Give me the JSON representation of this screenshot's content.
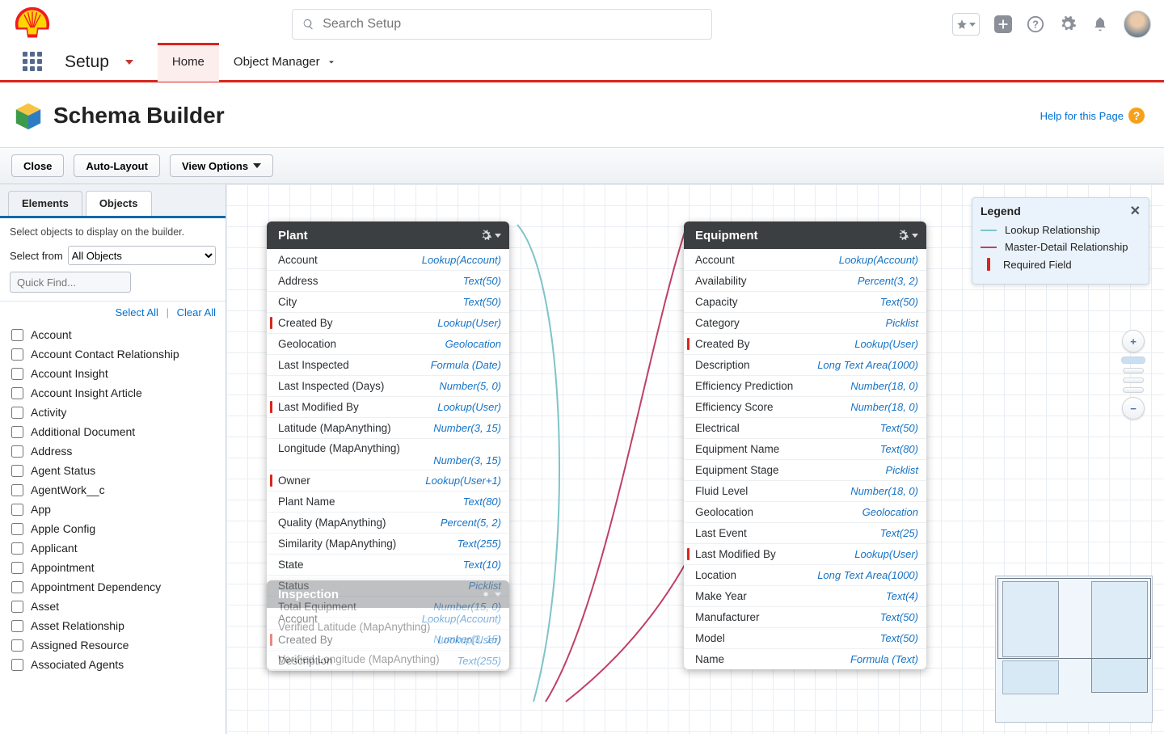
{
  "search": {
    "placeholder": "Search Setup"
  },
  "nav": {
    "app_title": "Setup",
    "tabs": [
      {
        "label": "Home",
        "active": true
      },
      {
        "label": "Object Manager",
        "active": false
      }
    ]
  },
  "page": {
    "title": "Schema Builder",
    "help_label": "Help for this Page"
  },
  "toolbar": {
    "close": "Close",
    "auto_layout": "Auto-Layout",
    "view_options": "View Options"
  },
  "sidebar": {
    "tabs": {
      "elements": "Elements",
      "objects": "Objects"
    },
    "help_text": "Select objects to display on the builder.",
    "select_from_label": "Select from",
    "select_from_value": "All Objects",
    "quickfind_placeholder": "Quick Find...",
    "select_all": "Select All",
    "clear_all": "Clear All",
    "objects": [
      "Account",
      "Account Contact Relationship",
      "Account Insight",
      "Account Insight Article",
      "Activity",
      "Additional Document",
      "Address",
      "Agent Status",
      "AgentWork__c",
      "App",
      "Apple Config",
      "Applicant",
      "Appointment",
      "Appointment Dependency",
      "Asset",
      "Asset Relationship",
      "Assigned Resource",
      "Associated Agents"
    ]
  },
  "legend": {
    "title": "Legend",
    "lookup": "Lookup Relationship",
    "master": "Master-Detail Relationship",
    "required": "Required Field"
  },
  "entities": {
    "plant": {
      "title": "Plant",
      "fields": [
        {
          "name": "Account",
          "type": "Lookup(Account)",
          "required": false
        },
        {
          "name": "Address",
          "type": "Text(50)",
          "required": false
        },
        {
          "name": "City",
          "type": "Text(50)",
          "required": false
        },
        {
          "name": "Created By",
          "type": "Lookup(User)",
          "required": true
        },
        {
          "name": "Geolocation",
          "type": "Geolocation",
          "required": false
        },
        {
          "name": "Last Inspected",
          "type": "Formula (Date)",
          "required": false
        },
        {
          "name": "Last Inspected (Days)",
          "type": "Number(5, 0)",
          "required": false
        },
        {
          "name": "Last Modified By",
          "type": "Lookup(User)",
          "required": true
        },
        {
          "name": "Latitude (MapAnything)",
          "type": "Number(3, 15)",
          "required": false
        },
        {
          "name": "Longitude (MapAnything)",
          "type": "Number(3, 15)",
          "required": false,
          "wrap": true
        },
        {
          "name": "Owner",
          "type": "Lookup(User+1)",
          "required": true
        },
        {
          "name": "Plant Name",
          "type": "Text(80)",
          "required": false
        },
        {
          "name": "Quality (MapAnything)",
          "type": "Percent(5, 2)",
          "required": false
        },
        {
          "name": "Similarity (MapAnything)",
          "type": "Text(255)",
          "required": false
        },
        {
          "name": "State",
          "type": "Text(10)",
          "required": false
        },
        {
          "name": "Status",
          "type": "Picklist",
          "required": false
        },
        {
          "name": "Total Equipment",
          "type": "Number(15, 0)",
          "required": false
        },
        {
          "name": "Verified Latitude (MapAnything)",
          "type": "Number(3, 15)",
          "required": false,
          "wrap": true
        },
        {
          "name": "Verified Longitude (MapAnything)",
          "type": "",
          "required": false
        }
      ]
    },
    "equipment": {
      "title": "Equipment",
      "fields": [
        {
          "name": "Account",
          "type": "Lookup(Account)",
          "required": false
        },
        {
          "name": "Availability",
          "type": "Percent(3, 2)",
          "required": false
        },
        {
          "name": "Capacity",
          "type": "Text(50)",
          "required": false
        },
        {
          "name": "Category",
          "type": "Picklist",
          "required": false
        },
        {
          "name": "Created By",
          "type": "Lookup(User)",
          "required": true
        },
        {
          "name": "Description",
          "type": "Long Text Area(1000)",
          "required": false
        },
        {
          "name": "Efficiency Prediction",
          "type": "Number(18, 0)",
          "required": false
        },
        {
          "name": "Efficiency Score",
          "type": "Number(18, 0)",
          "required": false
        },
        {
          "name": "Electrical",
          "type": "Text(50)",
          "required": false
        },
        {
          "name": "Equipment Name",
          "type": "Text(80)",
          "required": false
        },
        {
          "name": "Equipment Stage",
          "type": "Picklist",
          "required": false
        },
        {
          "name": "Fluid Level",
          "type": "Number(18, 0)",
          "required": false
        },
        {
          "name": "Geolocation",
          "type": "Geolocation",
          "required": false
        },
        {
          "name": "Last Event",
          "type": "Text(25)",
          "required": false
        },
        {
          "name": "Last Modified By",
          "type": "Lookup(User)",
          "required": true
        },
        {
          "name": "Location",
          "type": "Long Text Area(1000)",
          "required": false
        },
        {
          "name": "Make Year",
          "type": "Text(4)",
          "required": false
        },
        {
          "name": "Manufacturer",
          "type": "Text(50)",
          "required": false
        },
        {
          "name": "Model",
          "type": "Text(50)",
          "required": false
        },
        {
          "name": "Name",
          "type": "Formula (Text)",
          "required": false
        }
      ]
    },
    "inspection": {
      "title": "Inspection",
      "fields": [
        {
          "name": "Account",
          "type": "Lookup(Account)",
          "required": false
        },
        {
          "name": "Created By",
          "type": "Lookup(User)",
          "required": true
        },
        {
          "name": "Description",
          "type": "Text(255)",
          "required": false
        }
      ]
    }
  }
}
